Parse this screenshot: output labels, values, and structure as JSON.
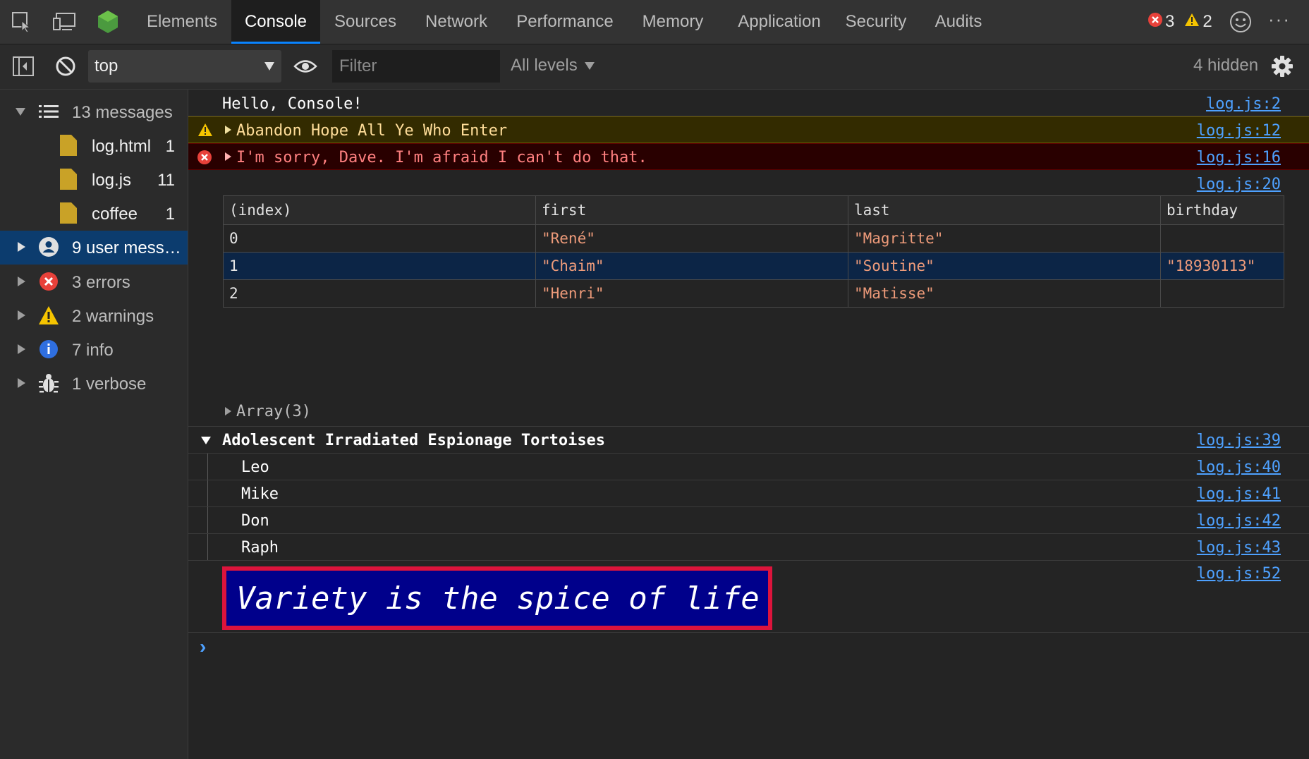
{
  "tabbar": {
    "tabs": [
      "Elements",
      "Console",
      "Sources",
      "Network",
      "Performance",
      "Memory",
      "Application",
      "Security",
      "Audits"
    ],
    "active_tab": "Console",
    "error_count": "3",
    "warning_count": "2",
    "more": "···"
  },
  "toolbar": {
    "context": "top",
    "filter_placeholder": "Filter",
    "levels": "All levels",
    "hidden": "4 hidden"
  },
  "sidebar": {
    "items": [
      {
        "label": "13 messages",
        "count": "",
        "icon": "list-icon"
      },
      {
        "label": "log.html",
        "count": "1",
        "icon": "file-icon"
      },
      {
        "label": "log.js",
        "count": "11",
        "icon": "file-icon"
      },
      {
        "label": "coffee",
        "count": "1",
        "icon": "file-icon"
      },
      {
        "label": "9 user mess…",
        "count": "",
        "icon": "user-icon"
      },
      {
        "label": "3 errors",
        "count": "",
        "icon": "error-icon"
      },
      {
        "label": "2 warnings",
        "count": "",
        "icon": "warning-icon"
      },
      {
        "label": "7 info",
        "count": "",
        "icon": "info-icon"
      },
      {
        "label": "1 verbose",
        "count": "",
        "icon": "bug-icon"
      }
    ]
  },
  "console": {
    "messages": [
      {
        "text": "Hello, Console!",
        "source": "log.js:2"
      },
      {
        "text": "Abandon Hope All Ye Who Enter",
        "source": "log.js:12"
      },
      {
        "text": "I'm sorry, Dave. I'm afraid I can't do that.",
        "source": "log.js:16"
      }
    ],
    "table_source": "log.js:20",
    "table": {
      "headers": [
        "(index)",
        "first",
        "last",
        "birthday"
      ],
      "rows": [
        [
          "0",
          "\"René\"",
          "\"Magritte\"",
          ""
        ],
        [
          "1",
          "\"Chaim\"",
          "\"Soutine\"",
          "\"18930113\""
        ],
        [
          "2",
          "\"Henri\"",
          "\"Matisse\"",
          ""
        ]
      ]
    },
    "array_label": "Array(3)",
    "group": {
      "title": "Adolescent Irradiated Espionage Tortoises",
      "source": "log.js:39",
      "items": [
        {
          "text": "Leo",
          "source": "log.js:40"
        },
        {
          "text": "Mike",
          "source": "log.js:41"
        },
        {
          "text": "Don",
          "source": "log.js:42"
        },
        {
          "text": "Raph",
          "source": "log.js:43"
        }
      ]
    },
    "styled": {
      "text": "Variety is the spice of life",
      "source": "log.js:52"
    },
    "prompt": "›"
  },
  "colors": {
    "accent": "#0a84ff",
    "error": "#e8413a",
    "warning": "#f5c400",
    "link": "#4ea1ff",
    "styled_bg": "#00008b",
    "styled_border": "#dc143c"
  }
}
